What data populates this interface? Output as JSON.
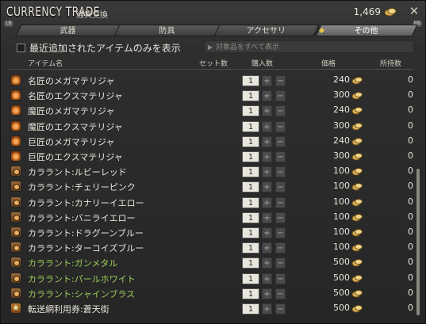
{
  "window": {
    "title": "CURRENCY TRADE",
    "subtitle": "通貨交換",
    "currency_amount": "1,469",
    "currency_icon": "gil-coin-icon",
    "close_icon": "close-icon"
  },
  "tabs": {
    "lb": "LB",
    "rb": "RB",
    "items": [
      {
        "label": "武器",
        "active": false
      },
      {
        "label": "防具",
        "active": false
      },
      {
        "label": "アクセサリ",
        "active": false
      },
      {
        "label": "その他",
        "active": true
      }
    ]
  },
  "filter": {
    "checkbox_label": "最近追加されたアイテムのみを表示",
    "show_all_label": "対象品をすべて表示"
  },
  "headers": {
    "item_name": "アイテム名",
    "set_count": "セット数",
    "purchase_qty": "購入数",
    "price": "価格",
    "owned": "所持数"
  },
  "rows": [
    {
      "icon": "materia",
      "name": "名匠のメガマテリジャ",
      "qty": "1",
      "price": "240",
      "owned": "0",
      "green": false
    },
    {
      "icon": "materia",
      "name": "名匠のエクスマテリジャ",
      "qty": "1",
      "price": "300",
      "owned": "0",
      "green": false
    },
    {
      "icon": "materia",
      "name": "魔匠のメガマテリジャ",
      "qty": "1",
      "price": "240",
      "owned": "0",
      "green": false
    },
    {
      "icon": "materia",
      "name": "魔匠のエクスマテリジャ",
      "qty": "1",
      "price": "300",
      "owned": "0",
      "green": false
    },
    {
      "icon": "materia",
      "name": "巨匠のメガマテリジャ",
      "qty": "1",
      "price": "240",
      "owned": "0",
      "green": false
    },
    {
      "icon": "materia",
      "name": "巨匠のエクスマテリジャ",
      "qty": "1",
      "price": "300",
      "owned": "0",
      "green": false
    },
    {
      "icon": "dye",
      "name": "カララント:ルビーレッド",
      "qty": "1",
      "price": "100",
      "owned": "0",
      "green": false
    },
    {
      "icon": "dye",
      "name": "カララント:チェリーピンク",
      "qty": "1",
      "price": "100",
      "owned": "0",
      "green": false
    },
    {
      "icon": "dye",
      "name": "カララント:カナリーイエロー",
      "qty": "1",
      "price": "100",
      "owned": "0",
      "green": false
    },
    {
      "icon": "dye",
      "name": "カララント:バニライエロー",
      "qty": "1",
      "price": "100",
      "owned": "0",
      "green": false
    },
    {
      "icon": "dye",
      "name": "カララント:ドラグーンブルー",
      "qty": "1",
      "price": "100",
      "owned": "0",
      "green": false
    },
    {
      "icon": "dye",
      "name": "カララント:ターコイズブルー",
      "qty": "1",
      "price": "100",
      "owned": "0",
      "green": false
    },
    {
      "icon": "dye",
      "name": "カララント:ガンメタル",
      "qty": "1",
      "price": "500",
      "owned": "0",
      "green": true
    },
    {
      "icon": "dye",
      "name": "カララント:パールホワイト",
      "qty": "1",
      "price": "500",
      "owned": "0",
      "green": true
    },
    {
      "icon": "dye",
      "name": "カララント:シャインブラス",
      "qty": "1",
      "price": "500",
      "owned": "0",
      "green": true
    },
    {
      "icon": "ticket",
      "name": "転送網利用券:蒼天街",
      "qty": "1",
      "price": "500",
      "owned": "0",
      "green": false
    }
  ],
  "buttons": {
    "plus": "+",
    "minus": "−"
  },
  "colors": {
    "highlight_green": "#9ccf5a",
    "tab_marker": "#e6c14a"
  }
}
